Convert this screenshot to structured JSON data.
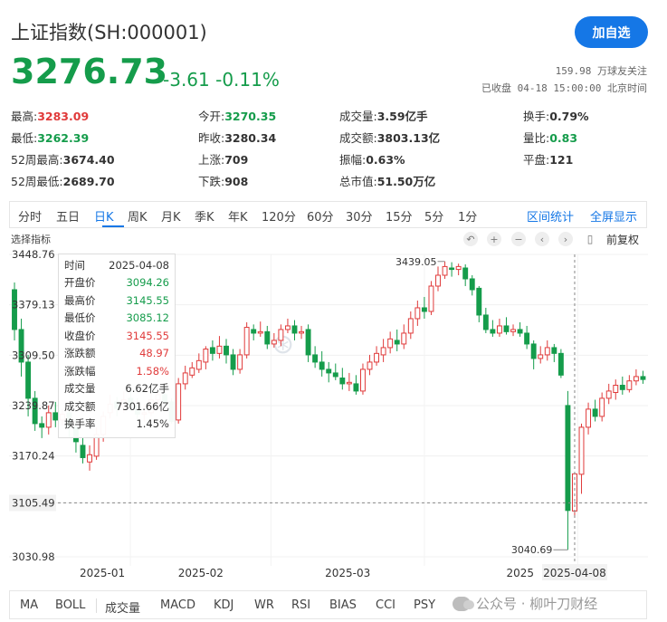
{
  "header": {
    "title": "上证指数(SH:000001)",
    "follow_label": "加自选",
    "price": "3276.73",
    "change": "-3.61",
    "change_pct": "-0.11%",
    "followers": "159.98 万球友关注",
    "status": "已收盘 04-18 15:00:00 北京时间"
  },
  "quote": {
    "high_label": "最高:",
    "high": "3283.09",
    "open_label": "今开:",
    "open": "3270.35",
    "volume_label": "成交量:",
    "volume": "3.59亿手",
    "turnover_label": "换手:",
    "turnover": "0.79%",
    "low_label": "最低:",
    "low": "3262.39",
    "prev_label": "昨收:",
    "prev": "3280.34",
    "amount_label": "成交额:",
    "amount": "3803.13亿",
    "vr_label": "量比:",
    "vr": "0.83",
    "w52h_label": "52周最高:",
    "w52h": "3674.40",
    "up_label": "上涨:",
    "up": "709",
    "amp_label": "振幅:",
    "amp": "0.63%",
    "flat_label": "平盘:",
    "flat": "121",
    "w52l_label": "52周最低:",
    "w52l": "2689.70",
    "down_label": "下跌:",
    "down": "908",
    "mcap_label": "总市值:",
    "mcap": "51.50万亿"
  },
  "periods": [
    "分时",
    "五日",
    "日K",
    "周K",
    "月K",
    "季K",
    "年K",
    "120分",
    "60分",
    "30分",
    "15分",
    "5分",
    "1分"
  ],
  "period_links": {
    "range": "区间统计",
    "full": "全屏显示"
  },
  "chart_toolbar": {
    "indicator_select": "选择指标",
    "fq": "前复权"
  },
  "tooltip": {
    "rows": [
      {
        "k": "时间",
        "v": "2025-04-08",
        "c": ""
      },
      {
        "k": "开盘价",
        "v": "3094.26",
        "c": "green"
      },
      {
        "k": "最高价",
        "v": "3145.55",
        "c": "green"
      },
      {
        "k": "最低价",
        "v": "3085.12",
        "c": "green"
      },
      {
        "k": "收盘价",
        "v": "3145.55",
        "c": "red"
      },
      {
        "k": "涨跌额",
        "v": "48.97",
        "c": "red"
      },
      {
        "k": "涨跌幅",
        "v": "1.58%",
        "c": "red"
      },
      {
        "k": "成交量",
        "v": "6.62亿手",
        "c": ""
      },
      {
        "k": "成交额",
        "v": "7301.66亿",
        "c": ""
      },
      {
        "k": "换手率",
        "v": "1.45%",
        "c": ""
      }
    ]
  },
  "indicators": [
    "MA",
    "BOLL",
    "成交量",
    "MACD",
    "KDJ",
    "WR",
    "RSI",
    "BIAS",
    "CCI",
    "PSY"
  ],
  "watermark": "公众号 · 柳叶刀财经",
  "colors": {
    "up": "#e03a3a",
    "down": "#159c4b",
    "accent": "#1577e6"
  },
  "chart_data": {
    "type": "candlestick",
    "ylim": [
      3030.98,
      3448.76
    ],
    "y_ticks": [
      "3448.76",
      "3379.13",
      "3309.50",
      "3239.87",
      "3170.24",
      "3105.49",
      "3030.98"
    ],
    "x_ticks": [
      "2025-01",
      "2025-02",
      "2025-03",
      "2025"
    ],
    "crosshair_x_label": "2025-04-08",
    "crosshair_y_label": "3105.49",
    "max_label": "3439.05",
    "min_label": "3040.69",
    "candles": [
      {
        "o": 3400,
        "c": 3345,
        "h": 3410,
        "l": 3330
      },
      {
        "o": 3345,
        "c": 3300,
        "h": 3360,
        "l": 3280
      },
      {
        "o": 3300,
        "c": 3250,
        "h": 3310,
        "l": 3225
      },
      {
        "o": 3250,
        "c": 3215,
        "h": 3260,
        "l": 3205
      },
      {
        "o": 3215,
        "c": 3210,
        "h": 3225,
        "l": 3195
      },
      {
        "o": 3210,
        "c": 3230,
        "h": 3240,
        "l": 3200
      },
      {
        "o": 3230,
        "c": 3220,
        "h": 3245,
        "l": 3210
      },
      {
        "o": 3220,
        "c": 3228,
        "h": 3235,
        "l": 3212
      },
      {
        "o": 3230,
        "c": 3210,
        "h": 3238,
        "l": 3195
      },
      {
        "o": 3210,
        "c": 3190,
        "h": 3222,
        "l": 3175
      },
      {
        "o": 3185,
        "c": 3168,
        "h": 3195,
        "l": 3160
      },
      {
        "o": 3162,
        "c": 3172,
        "h": 3185,
        "l": 3150
      },
      {
        "o": 3170,
        "c": 3200,
        "h": 3210,
        "l": 3165
      },
      {
        "o": 3200,
        "c": 3225,
        "h": 3232,
        "l": 3190
      },
      {
        "o": 3230,
        "c": 3242,
        "h": 3255,
        "l": 3222
      },
      {
        "o": 3245,
        "c": 3236,
        "h": 3252,
        "l": 3225
      },
      {
        "o": 3238,
        "c": 3248,
        "h": 3260,
        "l": 3230
      },
      {
        "o": 3250,
        "c": 3240,
        "h": 3262,
        "l": 3232
      },
      {
        "o": 3240,
        "c": 3228,
        "h": 3250,
        "l": 3220
      },
      {
        "o": 3228,
        "c": 3230,
        "h": 3242,
        "l": 3218
      },
      {
        "o": 3230,
        "c": 3248,
        "h": 3258,
        "l": 3225
      },
      {
        "o": 3248,
        "c": 3255,
        "h": 3262,
        "l": 3236
      },
      {
        "o": 3255,
        "c": 3245,
        "h": 3266,
        "l": 3240
      },
      {
        "o": 3245,
        "c": 3218,
        "h": 3250,
        "l": 3215
      },
      {
        "o": 3220,
        "c": 3270,
        "h": 3278,
        "l": 3215
      },
      {
        "o": 3270,
        "c": 3285,
        "h": 3295,
        "l": 3262
      },
      {
        "o": 3282,
        "c": 3292,
        "h": 3300,
        "l": 3278
      },
      {
        "o": 3290,
        "c": 3302,
        "h": 3312,
        "l": 3285
      },
      {
        "o": 3300,
        "c": 3318,
        "h": 3322,
        "l": 3290
      },
      {
        "o": 3320,
        "c": 3312,
        "h": 3330,
        "l": 3302
      },
      {
        "o": 3312,
        "c": 3322,
        "h": 3336,
        "l": 3305
      },
      {
        "o": 3322,
        "c": 3310,
        "h": 3332,
        "l": 3298
      },
      {
        "o": 3310,
        "c": 3290,
        "h": 3318,
        "l": 3282
      },
      {
        "o": 3290,
        "c": 3310,
        "h": 3318,
        "l": 3284
      },
      {
        "o": 3310,
        "c": 3348,
        "h": 3355,
        "l": 3305
      },
      {
        "o": 3345,
        "c": 3340,
        "h": 3352,
        "l": 3330
      },
      {
        "o": 3340,
        "c": 3342,
        "h": 3356,
        "l": 3335
      },
      {
        "o": 3342,
        "c": 3325,
        "h": 3350,
        "l": 3318
      },
      {
        "o": 3325,
        "c": 3330,
        "h": 3340,
        "l": 3320
      },
      {
        "o": 3330,
        "c": 3345,
        "h": 3352,
        "l": 3322
      },
      {
        "o": 3345,
        "c": 3350,
        "h": 3360,
        "l": 3340
      },
      {
        "o": 3350,
        "c": 3340,
        "h": 3358,
        "l": 3330
      },
      {
        "o": 3340,
        "c": 3342,
        "h": 3350,
        "l": 3332
      },
      {
        "o": 3345,
        "c": 3310,
        "h": 3352,
        "l": 3300
      },
      {
        "o": 3310,
        "c": 3300,
        "h": 3322,
        "l": 3292
      },
      {
        "o": 3300,
        "c": 3290,
        "h": 3315,
        "l": 3280
      },
      {
        "o": 3290,
        "c": 3285,
        "h": 3300,
        "l": 3272
      },
      {
        "o": 3285,
        "c": 3280,
        "h": 3298,
        "l": 3275
      },
      {
        "o": 3278,
        "c": 3270,
        "h": 3292,
        "l": 3262
      },
      {
        "o": 3270,
        "c": 3272,
        "h": 3285,
        "l": 3260
      },
      {
        "o": 3270,
        "c": 3260,
        "h": 3282,
        "l": 3255
      },
      {
        "o": 3260,
        "c": 3290,
        "h": 3298,
        "l": 3255
      },
      {
        "o": 3290,
        "c": 3300,
        "h": 3310,
        "l": 3282
      },
      {
        "o": 3300,
        "c": 3312,
        "h": 3322,
        "l": 3295
      },
      {
        "o": 3310,
        "c": 3320,
        "h": 3332,
        "l": 3300
      },
      {
        "o": 3320,
        "c": 3332,
        "h": 3342,
        "l": 3312
      },
      {
        "o": 3330,
        "c": 3325,
        "h": 3345,
        "l": 3315
      },
      {
        "o": 3325,
        "c": 3340,
        "h": 3352,
        "l": 3318
      },
      {
        "o": 3340,
        "c": 3360,
        "h": 3370,
        "l": 3332
      },
      {
        "o": 3360,
        "c": 3375,
        "h": 3385,
        "l": 3350
      },
      {
        "o": 3375,
        "c": 3370,
        "h": 3390,
        "l": 3360
      },
      {
        "o": 3370,
        "c": 3405,
        "h": 3412,
        "l": 3365
      },
      {
        "o": 3405,
        "c": 3420,
        "h": 3432,
        "l": 3398
      },
      {
        "o": 3420,
        "c": 3432,
        "h": 3439.05,
        "l": 3415
      },
      {
        "o": 3430,
        "c": 3428,
        "h": 3438,
        "l": 3418
      },
      {
        "o": 3428,
        "c": 3432,
        "h": 3436,
        "l": 3420
      },
      {
        "o": 3430,
        "c": 3415,
        "h": 3435,
        "l": 3405
      },
      {
        "o": 3415,
        "c": 3400,
        "h": 3420,
        "l": 3392
      },
      {
        "o": 3402,
        "c": 3365,
        "h": 3405,
        "l": 3355
      },
      {
        "o": 3365,
        "c": 3345,
        "h": 3375,
        "l": 3340
      },
      {
        "o": 3345,
        "c": 3340,
        "h": 3358,
        "l": 3335
      },
      {
        "o": 3340,
        "c": 3350,
        "h": 3360,
        "l": 3335
      },
      {
        "o": 3350,
        "c": 3342,
        "h": 3362,
        "l": 3338
      },
      {
        "o": 3342,
        "c": 3345,
        "h": 3352,
        "l": 3336
      },
      {
        "o": 3345,
        "c": 3340,
        "h": 3355,
        "l": 3335
      },
      {
        "o": 3340,
        "c": 3325,
        "h": 3350,
        "l": 3318
      },
      {
        "o": 3325,
        "c": 3305,
        "h": 3330,
        "l": 3290
      },
      {
        "o": 3305,
        "c": 3310,
        "h": 3322,
        "l": 3298
      },
      {
        "o": 3310,
        "c": 3320,
        "h": 3330,
        "l": 3302
      },
      {
        "o": 3320,
        "c": 3312,
        "h": 3325,
        "l": 3300
      },
      {
        "o": 3312,
        "c": 3282,
        "h": 3318,
        "l": 3278
      },
      {
        "o": 3240,
        "c": 3095,
        "h": 3260,
        "l": 3040.69
      },
      {
        "o": 3094.26,
        "c": 3145.55,
        "h": 3145.55,
        "l": 3085.12
      },
      {
        "o": 3145,
        "c": 3210,
        "h": 3215,
        "l": 3118
      },
      {
        "o": 3210,
        "c": 3235,
        "h": 3244,
        "l": 3200
      },
      {
        "o": 3235,
        "c": 3225,
        "h": 3248,
        "l": 3218
      },
      {
        "o": 3225,
        "c": 3250,
        "h": 3258,
        "l": 3218
      },
      {
        "o": 3250,
        "c": 3260,
        "h": 3270,
        "l": 3242
      },
      {
        "o": 3258,
        "c": 3268,
        "h": 3276,
        "l": 3248
      },
      {
        "o": 3268,
        "c": 3262,
        "h": 3280,
        "l": 3255
      },
      {
        "o": 3262,
        "c": 3274,
        "h": 3282,
        "l": 3258
      },
      {
        "o": 3274,
        "c": 3280,
        "h": 3290,
        "l": 3268
      },
      {
        "o": 3280,
        "c": 3276,
        "h": 3288,
        "l": 3270
      }
    ]
  }
}
